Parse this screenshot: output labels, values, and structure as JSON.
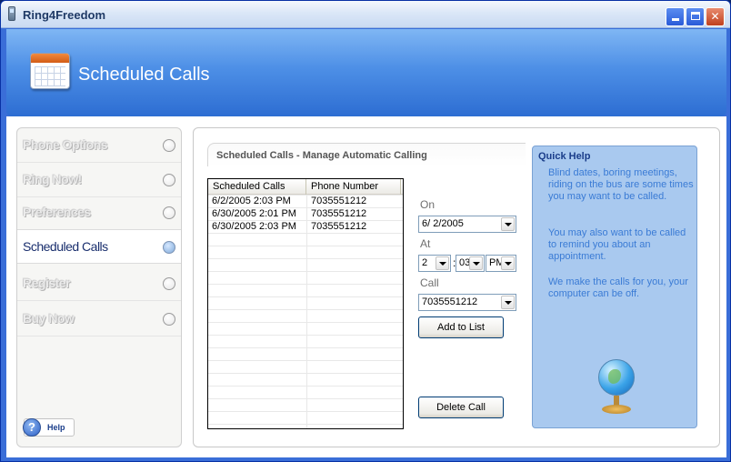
{
  "window": {
    "title": "Ring4Freedom",
    "controls": {
      "minimize": "minimize",
      "maximize": "maximize",
      "close": "✕"
    }
  },
  "banner": {
    "title": "Scheduled Calls",
    "icon": "calendar-icon"
  },
  "nav": {
    "items": [
      {
        "label": "Phone Options",
        "active": false
      },
      {
        "label": "Ring Now!",
        "active": false
      },
      {
        "label": "Preferences",
        "active": false
      },
      {
        "label": "Scheduled Calls",
        "active": true
      },
      {
        "label": "Register",
        "active": false
      },
      {
        "label": "Buy Now",
        "active": false
      }
    ],
    "help": {
      "icon": "?",
      "label": "Help"
    }
  },
  "main": {
    "section_title": "Scheduled Calls - Manage Automatic Calling",
    "list": {
      "columns": [
        "Scheduled Calls",
        "Phone Number"
      ],
      "rows": [
        {
          "when": "6/2/2005 2:03 PM",
          "phone": "7035551212"
        },
        {
          "when": "6/30/2005 2:01 PM",
          "phone": "7035551212"
        },
        {
          "when": "6/30/2005 2:03 PM",
          "phone": "7035551212"
        }
      ]
    },
    "form": {
      "on_label": "On",
      "date_value": "6/  2/2005",
      "at_label": "At",
      "hour_value": "2",
      "colon": ":",
      "minute_value": "03",
      "ampm_value": "PM",
      "call_label": "Call",
      "call_value": "7035551212",
      "add_button": "Add to List",
      "delete_button": "Delete Call"
    }
  },
  "quick_help": {
    "title": "Quick Help",
    "paragraphs": [
      "Blind dates, boring meetings, riding on the bus are some times you may want to be called.",
      "You may also want to be called to remind you about an appointment.",
      "We make the calls for you, your computer can be off."
    ],
    "icon": "globe-icon"
  },
  "colors": {
    "title_bar": "#dbe7f7",
    "banner": "#4d8fe6",
    "quick_help_bg": "#a9c9ef",
    "quick_help_text": "#3a7bd5",
    "active_nav_text": "#1a2f6e"
  }
}
